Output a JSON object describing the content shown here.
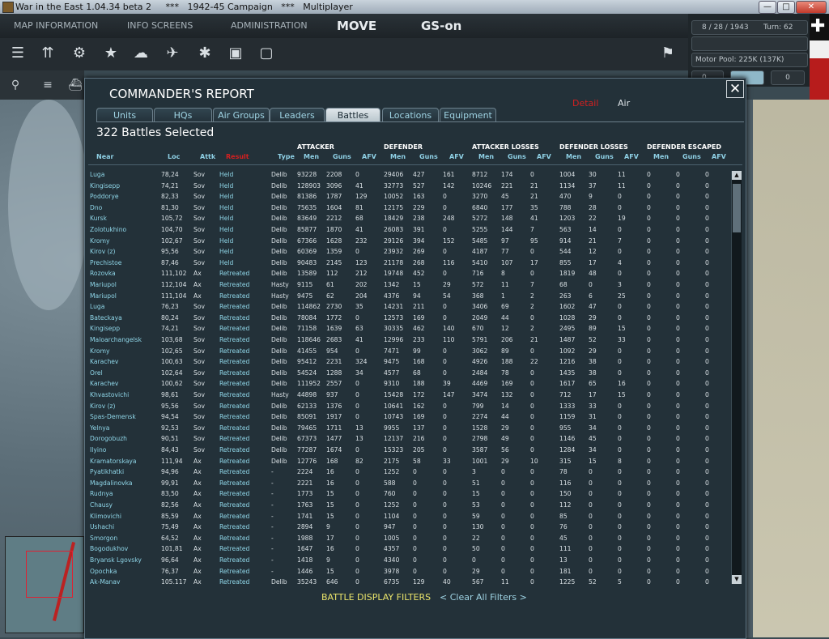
{
  "window": {
    "title": "War in the East 1.04.34 beta 2     ***   1942-45 Campaign   ***   Multiplayer",
    "minimize": "—",
    "maximize": "□",
    "close": "✕"
  },
  "menu": {
    "map_info": "MAP INFORMATION",
    "info_screens": "INFO SCREENS",
    "administration": "ADMINISTRATION",
    "move": "MOVE",
    "gs": "GS-on"
  },
  "status": {
    "date": "8 / 28 / 1943",
    "turn": "Turn: 62",
    "motor_pool": "Motor Pool:  225K (137K)",
    "counter": "0"
  },
  "dialog": {
    "title": "COMMANDER'S REPORT",
    "close": "✕",
    "selector": {
      "detail": "Detail",
      "air": "Air"
    },
    "tabs": [
      "Units",
      "HQs",
      "Air Groups",
      "Leaders",
      "Battles",
      "Locations",
      "Equipment"
    ],
    "active_tab": "Battles",
    "count": "322 Battles Selected",
    "groups": {
      "attacker": "ATTACKER",
      "defender": "DEFENDER",
      "att_losses": "ATTACKER LOSSES",
      "def_losses": "DEFENDER LOSSES",
      "def_escaped": "DEFENDER ESCAPED"
    },
    "columns": [
      "Near",
      "Loc",
      "Attk",
      "Result",
      "Type",
      "Men",
      "Guns",
      "AFV",
      "Men",
      "Guns",
      "AFV",
      "Men",
      "Guns",
      "AFV",
      "Men",
      "Guns",
      "AFV",
      "Men",
      "Guns",
      "AFV"
    ],
    "battle_filters": "BATTLE DISPLAY FILTERS",
    "clear_filters": "< Clear All Filters >"
  },
  "battles": [
    [
      "Luga",
      "78,24",
      "Sov",
      "Held",
      "Delib",
      "93228",
      "2208",
      "0",
      "29406",
      "427",
      "161",
      "8712",
      "174",
      "0",
      "1004",
      "30",
      "11",
      "0",
      "0",
      "0"
    ],
    [
      "Kingisepp",
      "74,21",
      "Sov",
      "Held",
      "Delib",
      "128903",
      "3096",
      "41",
      "32773",
      "527",
      "142",
      "10246",
      "221",
      "21",
      "1134",
      "37",
      "11",
      "0",
      "0",
      "0"
    ],
    [
      "Poddorye",
      "82,33",
      "Sov",
      "Held",
      "Delib",
      "81386",
      "1787",
      "129",
      "10052",
      "163",
      "0",
      "3270",
      "45",
      "21",
      "470",
      "9",
      "0",
      "0",
      "0",
      "0"
    ],
    [
      "Dno",
      "81,30",
      "Sov",
      "Held",
      "Delib",
      "75635",
      "1604",
      "81",
      "12175",
      "229",
      "0",
      "6840",
      "177",
      "35",
      "788",
      "28",
      "0",
      "0",
      "0",
      "0"
    ],
    [
      "Kursk",
      "105,72",
      "Sov",
      "Held",
      "Delib",
      "83649",
      "2212",
      "68",
      "18429",
      "238",
      "248",
      "5272",
      "148",
      "41",
      "1203",
      "22",
      "19",
      "0",
      "0",
      "0"
    ],
    [
      "Zolotukhino",
      "104,70",
      "Sov",
      "Held",
      "Delib",
      "85877",
      "1870",
      "41",
      "26083",
      "391",
      "0",
      "5255",
      "144",
      "7",
      "563",
      "14",
      "0",
      "0",
      "0",
      "0"
    ],
    [
      "Kromy",
      "102,67",
      "Sov",
      "Held",
      "Delib",
      "67366",
      "1628",
      "232",
      "29126",
      "394",
      "152",
      "5485",
      "97",
      "95",
      "914",
      "21",
      "7",
      "0",
      "0",
      "0"
    ],
    [
      "Kirov (z)",
      "95,56",
      "Sov",
      "Held",
      "Delib",
      "60369",
      "1359",
      "0",
      "23932",
      "269",
      "0",
      "4187",
      "77",
      "0",
      "544",
      "12",
      "0",
      "0",
      "0",
      "0"
    ],
    [
      "Prechistoe",
      "87,46",
      "Sov",
      "Held",
      "Delib",
      "90483",
      "2145",
      "123",
      "21178",
      "268",
      "116",
      "5410",
      "107",
      "17",
      "855",
      "17",
      "4",
      "0",
      "0",
      "0"
    ],
    [
      "Rozovka",
      "111,102",
      "Ax",
      "Retreated",
      "Delib",
      "13589",
      "112",
      "212",
      "19748",
      "452",
      "0",
      "716",
      "8",
      "0",
      "1819",
      "48",
      "0",
      "0",
      "0",
      "0"
    ],
    [
      "Mariupol",
      "112,104",
      "Ax",
      "Retreated",
      "Hasty",
      "9115",
      "61",
      "202",
      "1342",
      "15",
      "29",
      "572",
      "11",
      "7",
      "68",
      "0",
      "3",
      "0",
      "0",
      "0"
    ],
    [
      "Mariupol",
      "111,104",
      "Ax",
      "Retreated",
      "Hasty",
      "9475",
      "62",
      "204",
      "4376",
      "94",
      "54",
      "368",
      "1",
      "2",
      "263",
      "6",
      "25",
      "0",
      "0",
      "0"
    ],
    [
      "Luga",
      "76,23",
      "Sov",
      "Retreated",
      "Delib",
      "114862",
      "2730",
      "35",
      "14231",
      "211",
      "0",
      "3406",
      "69",
      "2",
      "1602",
      "47",
      "0",
      "0",
      "0",
      "0"
    ],
    [
      "Bateckaya",
      "80,24",
      "Sov",
      "Retreated",
      "Delib",
      "78084",
      "1772",
      "0",
      "12573",
      "169",
      "0",
      "2049",
      "44",
      "0",
      "1028",
      "29",
      "0",
      "0",
      "0",
      "0"
    ],
    [
      "Kingisepp",
      "74,21",
      "Sov",
      "Retreated",
      "Delib",
      "71158",
      "1639",
      "63",
      "30335",
      "462",
      "140",
      "670",
      "12",
      "2",
      "2495",
      "89",
      "15",
      "0",
      "0",
      "0"
    ],
    [
      "Maloarchangelsk",
      "103,68",
      "Sov",
      "Retreated",
      "Delib",
      "118646",
      "2683",
      "41",
      "12996",
      "233",
      "110",
      "5791",
      "206",
      "21",
      "1487",
      "52",
      "33",
      "0",
      "0",
      "0"
    ],
    [
      "Kromy",
      "102,65",
      "Sov",
      "Retreated",
      "Delib",
      "41455",
      "954",
      "0",
      "7471",
      "99",
      "0",
      "3062",
      "89",
      "0",
      "1092",
      "29",
      "0",
      "0",
      "0",
      "0"
    ],
    [
      "Karachev",
      "100,63",
      "Sov",
      "Retreated",
      "Delib",
      "95412",
      "2231",
      "324",
      "9475",
      "168",
      "0",
      "4926",
      "188",
      "22",
      "1216",
      "38",
      "0",
      "0",
      "0",
      "0"
    ],
    [
      "Orel",
      "102,64",
      "Sov",
      "Retreated",
      "Delib",
      "54524",
      "1288",
      "34",
      "4577",
      "68",
      "0",
      "2484",
      "78",
      "0",
      "1435",
      "38",
      "0",
      "0",
      "0",
      "0"
    ],
    [
      "Karachev",
      "100,62",
      "Sov",
      "Retreated",
      "Delib",
      "111952",
      "2557",
      "0",
      "9310",
      "188",
      "39",
      "4469",
      "169",
      "0",
      "1617",
      "65",
      "16",
      "0",
      "0",
      "0"
    ],
    [
      "Khvastovichi",
      "98,61",
      "Sov",
      "Retreated",
      "Hasty",
      "44898",
      "937",
      "0",
      "15428",
      "172",
      "147",
      "3474",
      "132",
      "0",
      "712",
      "17",
      "15",
      "0",
      "0",
      "0"
    ],
    [
      "Kirov (z)",
      "95,56",
      "Sov",
      "Retreated",
      "Delib",
      "62133",
      "1376",
      "0",
      "10641",
      "162",
      "0",
      "799",
      "14",
      "0",
      "1333",
      "33",
      "0",
      "0",
      "0",
      "0"
    ],
    [
      "Spas-Demensk",
      "94,54",
      "Sov",
      "Retreated",
      "Delib",
      "85091",
      "1917",
      "0",
      "10743",
      "169",
      "0",
      "2274",
      "44",
      "0",
      "1159",
      "31",
      "0",
      "0",
      "0",
      "0"
    ],
    [
      "Yelnya",
      "92,53",
      "Sov",
      "Retreated",
      "Delib",
      "79465",
      "1711",
      "13",
      "9955",
      "137",
      "0",
      "1528",
      "29",
      "0",
      "955",
      "34",
      "0",
      "0",
      "0",
      "0"
    ],
    [
      "Dorogobuzh",
      "90,51",
      "Sov",
      "Retreated",
      "Delib",
      "67373",
      "1477",
      "13",
      "12137",
      "216",
      "0",
      "2798",
      "49",
      "0",
      "1146",
      "45",
      "0",
      "0",
      "0",
      "0"
    ],
    [
      "Ilyino",
      "84,43",
      "Sov",
      "Retreated",
      "Delib",
      "77287",
      "1674",
      "0",
      "15323",
      "205",
      "0",
      "3587",
      "56",
      "0",
      "1284",
      "34",
      "0",
      "0",
      "0",
      "0"
    ],
    [
      "Kramatorskaya",
      "111,94",
      "Ax",
      "Retreated",
      "Delib",
      "12776",
      "168",
      "82",
      "2175",
      "58",
      "33",
      "1001",
      "29",
      "10",
      "315",
      "15",
      "8",
      "0",
      "0",
      "0"
    ],
    [
      "Pyatikhatki",
      "94,96",
      "Ax",
      "Retreated",
      "-",
      "2224",
      "16",
      "0",
      "1252",
      "0",
      "0",
      "3",
      "0",
      "0",
      "78",
      "0",
      "0",
      "0",
      "0",
      "0"
    ],
    [
      "Magdalinovka",
      "99,91",
      "Ax",
      "Retreated",
      "-",
      "2221",
      "16",
      "0",
      "588",
      "0",
      "0",
      "51",
      "0",
      "0",
      "116",
      "0",
      "0",
      "0",
      "0",
      "0"
    ],
    [
      "Rudnya",
      "83,50",
      "Ax",
      "Retreated",
      "-",
      "1773",
      "15",
      "0",
      "760",
      "0",
      "0",
      "15",
      "0",
      "0",
      "150",
      "0",
      "0",
      "0",
      "0",
      "0"
    ],
    [
      "Chausy",
      "82,56",
      "Ax",
      "Retreated",
      "-",
      "1763",
      "15",
      "0",
      "1252",
      "0",
      "0",
      "53",
      "0",
      "0",
      "112",
      "0",
      "0",
      "0",
      "0",
      "0"
    ],
    [
      "Klimovichi",
      "85,59",
      "Ax",
      "Retreated",
      "-",
      "1741",
      "15",
      "0",
      "1104",
      "0",
      "0",
      "59",
      "0",
      "0",
      "85",
      "0",
      "0",
      "0",
      "0",
      "0"
    ],
    [
      "Ushachi",
      "75,49",
      "Ax",
      "Retreated",
      "-",
      "2894",
      "9",
      "0",
      "947",
      "0",
      "0",
      "130",
      "0",
      "0",
      "76",
      "0",
      "0",
      "0",
      "0",
      "0"
    ],
    [
      "Smorgon",
      "64,52",
      "Ax",
      "Retreated",
      "-",
      "1988",
      "17",
      "0",
      "1005",
      "0",
      "0",
      "22",
      "0",
      "0",
      "45",
      "0",
      "0",
      "0",
      "0",
      "0"
    ],
    [
      "Bogodukhov",
      "101,81",
      "Ax",
      "Retreated",
      "-",
      "1647",
      "16",
      "0",
      "4357",
      "0",
      "0",
      "50",
      "0",
      "0",
      "111",
      "0",
      "0",
      "0",
      "0",
      "0"
    ],
    [
      "Bryansk Lgovsky",
      "96,64",
      "Ax",
      "Retreated",
      "-",
      "1418",
      "9",
      "0",
      "4340",
      "0",
      "0",
      "0",
      "0",
      "0",
      "13",
      "0",
      "0",
      "0",
      "0",
      "0"
    ],
    [
      "Opochka",
      "76,37",
      "Ax",
      "Retreated",
      "-",
      "1446",
      "15",
      "0",
      "3978",
      "0",
      "0",
      "29",
      "0",
      "0",
      "181",
      "0",
      "0",
      "0",
      "0",
      "0"
    ],
    [
      "Ak-Manay",
      "105,117",
      "Ax",
      "Retreated",
      "Delib",
      "35243",
      "646",
      "0",
      "6735",
      "129",
      "40",
      "567",
      "11",
      "0",
      "1225",
      "52",
      "5",
      "0",
      "0",
      "0"
    ]
  ]
}
